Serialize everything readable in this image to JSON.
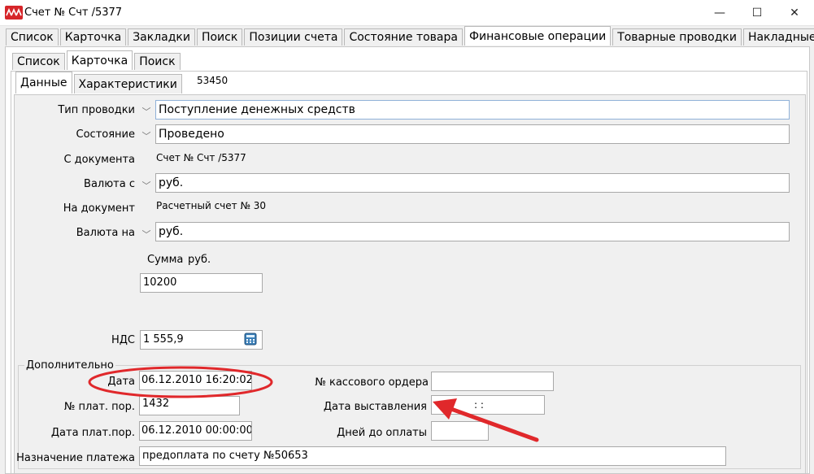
{
  "window": {
    "title": "Счет № Счт /5377",
    "minimize_glyph": "—",
    "maximize_glyph": "☐",
    "close_glyph": "✕"
  },
  "main_tabs": [
    "Список",
    "Карточка",
    "Закладки",
    "Поиск",
    "Позиции счета",
    "Состояние товара",
    "Финансовые операции",
    "Товарные проводки",
    "Накладные"
  ],
  "main_tabs_active": 6,
  "sub_tabs": [
    "Список",
    "Карточка",
    "Поиск"
  ],
  "sub_tabs_active": 1,
  "card_tabs": [
    "Данные",
    "Характеристики"
  ],
  "card_tabs_active": 0,
  "record_id": "53450",
  "form": {
    "type_label": "Тип проводки",
    "type_value": "Поступление денежных средств",
    "state_label": "Состояние",
    "state_value": "Проведено",
    "from_doc_label": "С документа",
    "from_doc_value": "Счет № Счт /5377",
    "currency_from_label": "Валюта с",
    "currency_from_value": "руб.",
    "to_doc_label": "На документ",
    "to_doc_value": "Расчетный счет № 30",
    "currency_to_label": "Валюта на",
    "currency_to_value": "руб.",
    "sum_label": "Сумма",
    "sum_currency": "руб.",
    "sum_value": "10200",
    "vat_label": "НДС",
    "vat_value": "1 555,9"
  },
  "extra": {
    "group_title": "Дополнительно",
    "date_label": "Дата",
    "date_value": "06.12.2010 16:20:02",
    "payorder_label": "№ плат. пор.",
    "payorder_value": "1432",
    "payorder_date_label": "Дата плат.пор.",
    "payorder_date_value": "06.12.2010 00:00:00",
    "purpose_label": "Назначение платежа",
    "purpose_value": "предоплата по счету №50653",
    "cash_order_label": "№ кассового ордера",
    "cash_order_value": "",
    "issue_date_label": "Дата выставления",
    "issue_date_value": ": :",
    "days_label": "Дней до оплаты",
    "days_value": ""
  },
  "colors": {
    "annotation_red": "#e0282b",
    "app_icon": "#d6262a",
    "field_border_blue": "#8fb1d8"
  }
}
